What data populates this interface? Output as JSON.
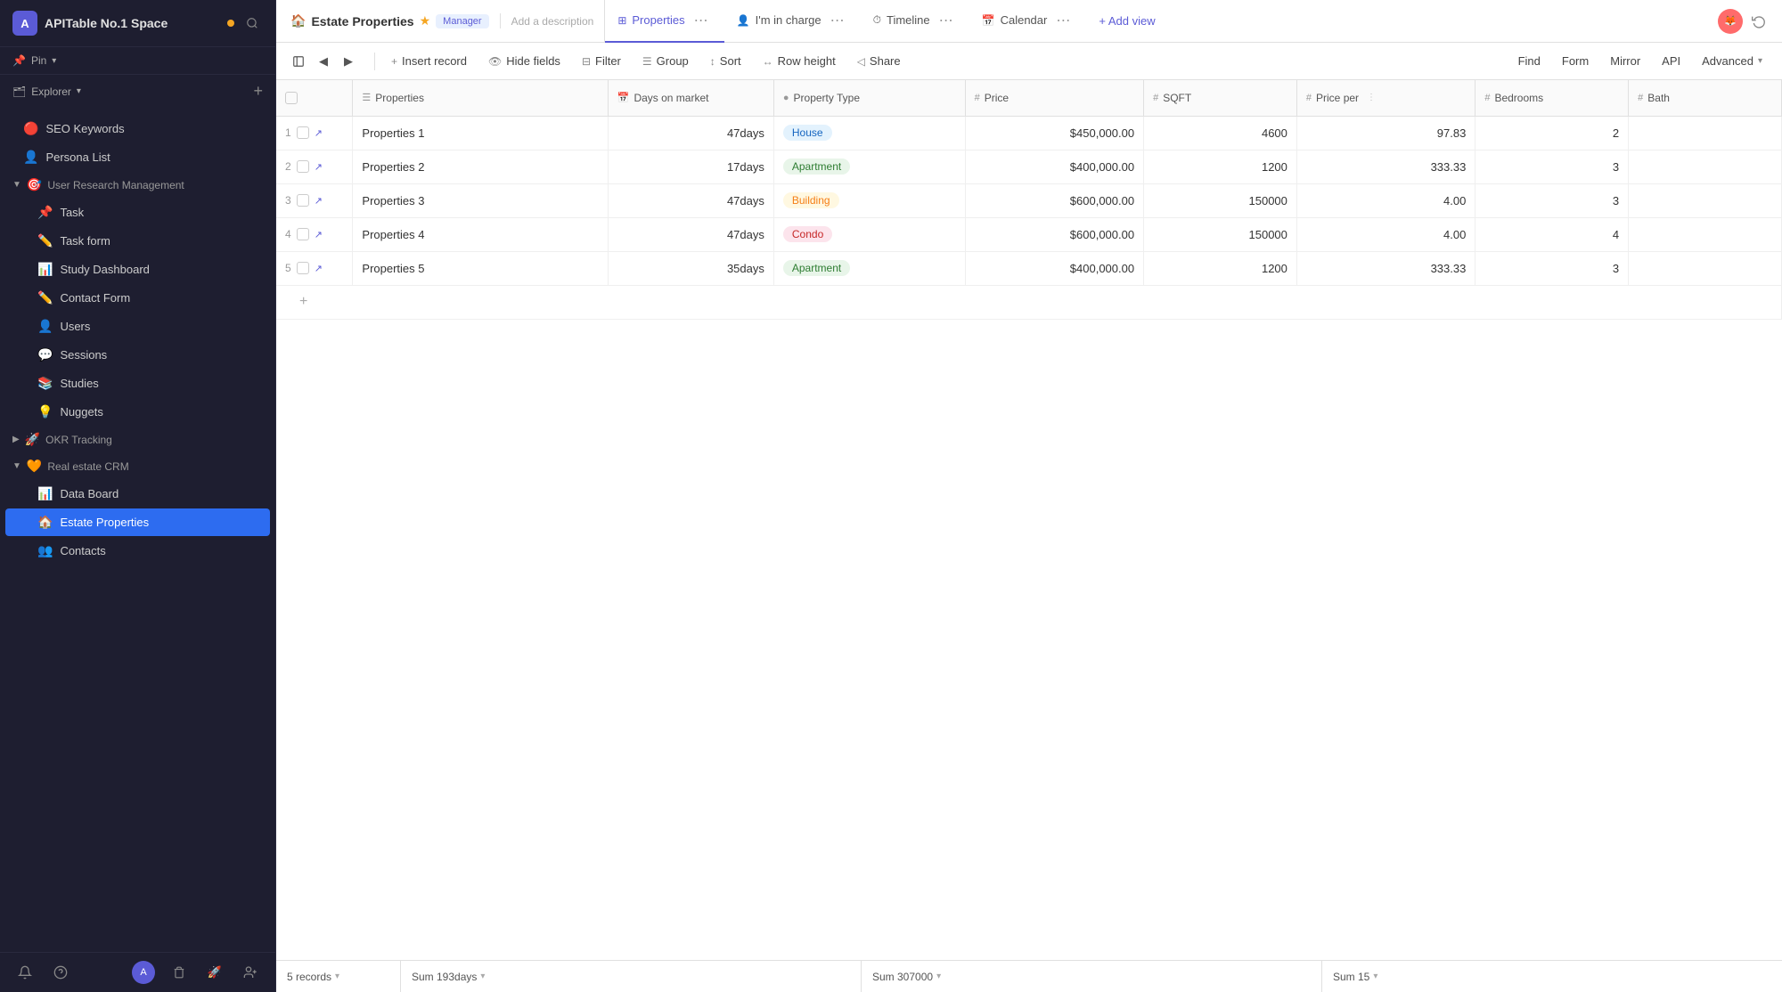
{
  "app": {
    "icon": "A",
    "title": "APITable No.1 Space",
    "dot_color": "#f5a623"
  },
  "sidebar": {
    "pin_label": "Pin",
    "explorer_label": "Explorer",
    "nav_items": [
      {
        "id": "seo-keywords",
        "icon": "🔴",
        "label": "SEO Keywords",
        "indent": false
      },
      {
        "id": "persona-list",
        "icon": "👤",
        "label": "Persona List",
        "indent": false
      },
      {
        "id": "user-research",
        "icon": "🎯",
        "label": "User Research Management",
        "is_section": true,
        "expanded": true
      },
      {
        "id": "task",
        "icon": "📌",
        "label": "Task",
        "indent": true
      },
      {
        "id": "task-form",
        "icon": "✏️",
        "label": "Task form",
        "indent": true
      },
      {
        "id": "study-dashboard",
        "icon": "📊",
        "label": "Study Dashboard",
        "indent": true
      },
      {
        "id": "contact-form",
        "icon": "✏️",
        "label": "Contact Form",
        "indent": true
      },
      {
        "id": "users",
        "icon": "👤",
        "label": "Users",
        "indent": true
      },
      {
        "id": "sessions",
        "icon": "💬",
        "label": "Sessions",
        "indent": true
      },
      {
        "id": "studies",
        "icon": "📚",
        "label": "Studies",
        "indent": true
      },
      {
        "id": "nuggets",
        "icon": "💡",
        "label": "Nuggets",
        "indent": true
      },
      {
        "id": "okr-tracking",
        "icon": "🚀",
        "label": "OKR Tracking",
        "is_section": true,
        "expanded": false
      },
      {
        "id": "real-estate",
        "icon": "🧡",
        "label": "Real estate CRM",
        "is_section": true,
        "expanded": true
      },
      {
        "id": "data-board",
        "icon": "📊",
        "label": "Data Board",
        "indent": true
      },
      {
        "id": "estate-properties",
        "icon": "🏠",
        "label": "Estate Properties",
        "indent": true,
        "active": true
      },
      {
        "id": "contacts",
        "icon": "👥",
        "label": "Contacts",
        "indent": true
      }
    ]
  },
  "topbar": {
    "breadcrumb_icon": "🏠",
    "breadcrumb_text": "Estate Properties",
    "breadcrumb_manager": "Manager",
    "description": "Add a description",
    "views": [
      {
        "id": "properties",
        "icon": "⊞",
        "label": "Properties",
        "active": true
      },
      {
        "id": "im-in-charge",
        "icon": "👤",
        "label": "I'm in charge",
        "active": false
      },
      {
        "id": "timeline",
        "icon": "⏱",
        "label": "Timeline",
        "active": false
      },
      {
        "id": "calendar",
        "icon": "📅",
        "label": "Calendar",
        "active": false
      }
    ],
    "add_view": "+ Add view"
  },
  "toolbar": {
    "description": "Add a description",
    "buttons": [
      {
        "id": "insert",
        "icon": "+",
        "label": "Insert record"
      },
      {
        "id": "hide",
        "icon": "👁",
        "label": "Hide fields"
      },
      {
        "id": "filter",
        "icon": "⊟",
        "label": "Filter"
      },
      {
        "id": "group",
        "icon": "☰",
        "label": "Group"
      },
      {
        "id": "sort",
        "icon": "↕",
        "label": "Sort"
      },
      {
        "id": "row-height",
        "icon": "↔",
        "label": "Row height"
      },
      {
        "id": "share",
        "icon": "◁",
        "label": "Share"
      }
    ],
    "right_buttons": [
      {
        "id": "find",
        "label": "Find"
      },
      {
        "id": "form",
        "label": "Form"
      },
      {
        "id": "mirror",
        "label": "Mirror"
      },
      {
        "id": "api",
        "label": "API"
      },
      {
        "id": "advanced",
        "label": "Advanced"
      }
    ]
  },
  "table": {
    "columns": [
      {
        "id": "check",
        "label": "",
        "type": "check"
      },
      {
        "id": "properties",
        "label": "Properties",
        "icon": "☰"
      },
      {
        "id": "days",
        "label": "Days on market",
        "icon": "📅"
      },
      {
        "id": "type",
        "label": "Property Type",
        "icon": "●"
      },
      {
        "id": "price",
        "label": "Price",
        "icon": "#"
      },
      {
        "id": "sqft",
        "label": "SQFT",
        "icon": "#"
      },
      {
        "id": "priceper",
        "label": "Price per",
        "icon": "#"
      },
      {
        "id": "bedrooms",
        "label": "Bedrooms",
        "icon": "#"
      },
      {
        "id": "baths",
        "label": "Bath",
        "icon": "#"
      }
    ],
    "rows": [
      {
        "num": 1,
        "name": "Properties 1",
        "days": "47days",
        "type": "House",
        "type_class": "tag-house",
        "price": "$450,000.00",
        "sqft": "4600",
        "priceper": "97.83",
        "bedrooms": "2",
        "baths": ""
      },
      {
        "num": 2,
        "name": "Properties 2",
        "days": "17days",
        "type": "Apartment",
        "type_class": "tag-apartment",
        "price": "$400,000.00",
        "sqft": "1200",
        "priceper": "333.33",
        "bedrooms": "3",
        "baths": ""
      },
      {
        "num": 3,
        "name": "Properties 3",
        "days": "47days",
        "type": "Building",
        "type_class": "tag-building",
        "price": "$600,000.00",
        "sqft": "150000",
        "priceper": "4.00",
        "bedrooms": "3",
        "baths": ""
      },
      {
        "num": 4,
        "name": "Properties 4",
        "days": "47days",
        "type": "Condo",
        "type_class": "tag-condo",
        "price": "$600,000.00",
        "sqft": "150000",
        "priceper": "4.00",
        "bedrooms": "4",
        "baths": ""
      },
      {
        "num": 5,
        "name": "Properties 5",
        "days": "35days",
        "type": "Apartment",
        "type_class": "tag-apartment",
        "price": "$400,000.00",
        "sqft": "1200",
        "priceper": "333.33",
        "bedrooms": "3",
        "baths": ""
      }
    ]
  },
  "footer": {
    "records": "5 records",
    "days_sum": "Sum 193days",
    "sqft_sum": "Sum 307000",
    "beds_sum": "Sum 15"
  }
}
